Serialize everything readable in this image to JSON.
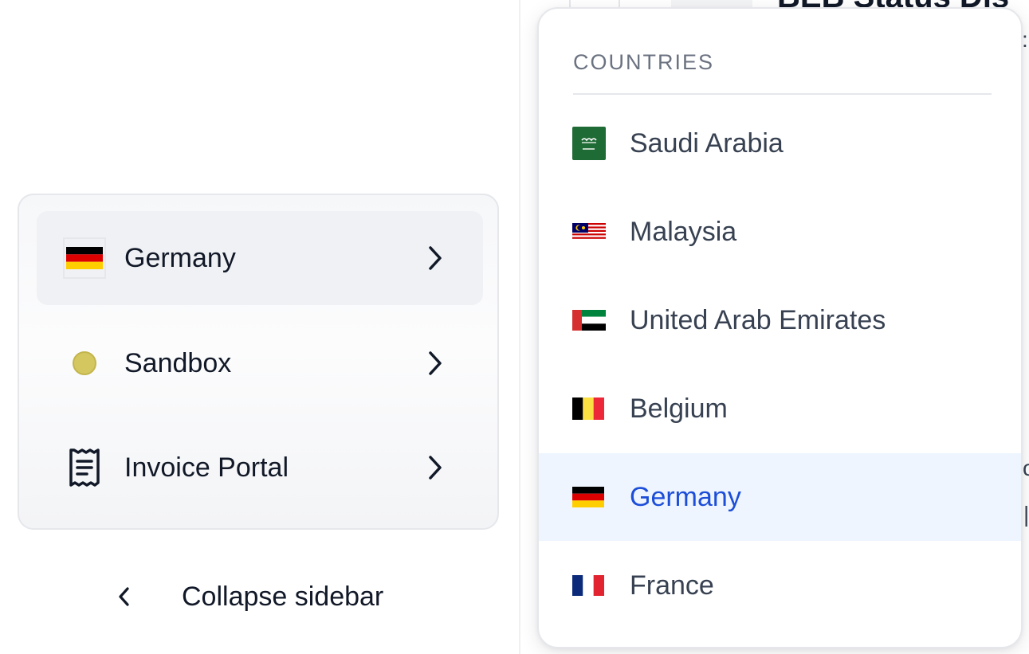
{
  "background": {
    "page_title_fragment": "BEB Status Dis"
  },
  "sidebar": {
    "items": [
      {
        "label": "Germany",
        "lead": "germany-flag",
        "active": true
      },
      {
        "label": "Sandbox",
        "lead": "status-dot",
        "dot_color": "#d4c760"
      },
      {
        "label": "Invoice Portal",
        "lead": "receipt-icon"
      }
    ],
    "collapse_label": "Collapse sidebar"
  },
  "dropdown": {
    "header": "COUNTRIES",
    "accent_color": "#1d4ed8",
    "selected_bg": "#eef5fe",
    "items": [
      {
        "name": "Saudi Arabia",
        "flag": "saudi-arabia-flag"
      },
      {
        "name": "Malaysia",
        "flag": "malaysia-flag"
      },
      {
        "name": "United Arab Emirates",
        "flag": "uae-flag"
      },
      {
        "name": "Belgium",
        "flag": "belgium-flag"
      },
      {
        "name": "Germany",
        "flag": "germany-flag",
        "selected": true
      },
      {
        "name": "France",
        "flag": "france-flag"
      }
    ]
  }
}
